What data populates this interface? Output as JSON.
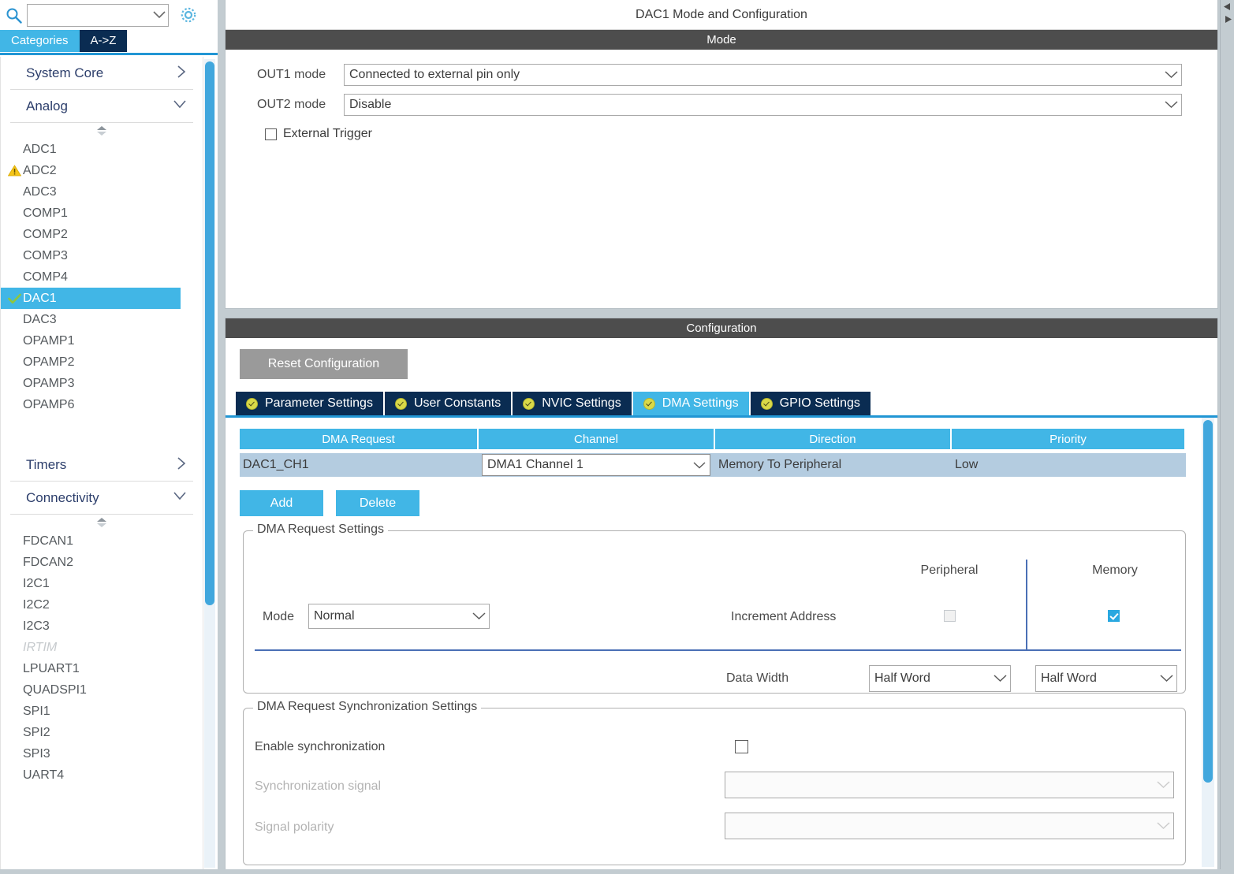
{
  "sidebar": {
    "search": {
      "icon": "search-icon",
      "value": "",
      "placeholder": ""
    },
    "gear_icon": "gear-icon",
    "mode_tabs": [
      {
        "label": "Categories",
        "selected": true
      },
      {
        "label": "A->Z",
        "selected": false
      }
    ],
    "groups": [
      {
        "name": "System Core",
        "arrow": "›",
        "expanded": false,
        "items": []
      },
      {
        "name": "Analog",
        "arrow": "∨",
        "expanded": true,
        "items": [
          {
            "label": "ADC1",
            "icon": "",
            "state": "normal"
          },
          {
            "label": "ADC2",
            "icon": "warning-icon",
            "state": "warning"
          },
          {
            "label": "ADC3",
            "icon": "",
            "state": "normal"
          },
          {
            "label": "COMP1",
            "icon": "",
            "state": "normal"
          },
          {
            "label": "COMP2",
            "icon": "",
            "state": "normal"
          },
          {
            "label": "COMP3",
            "icon": "",
            "state": "normal"
          },
          {
            "label": "COMP4",
            "icon": "",
            "state": "normal"
          },
          {
            "label": "DAC1",
            "icon": "check-icon",
            "state": "selected"
          },
          {
            "label": "DAC3",
            "icon": "",
            "state": "normal"
          },
          {
            "label": "OPAMP1",
            "icon": "",
            "state": "normal"
          },
          {
            "label": "OPAMP2",
            "icon": "",
            "state": "normal"
          },
          {
            "label": "OPAMP3",
            "icon": "",
            "state": "normal"
          },
          {
            "label": "OPAMP6",
            "icon": "",
            "state": "normal"
          }
        ]
      },
      {
        "name": "Timers",
        "arrow": "›",
        "expanded": false,
        "items": []
      },
      {
        "name": "Connectivity",
        "arrow": "∨",
        "expanded": true,
        "items": [
          {
            "label": "FDCAN1",
            "icon": "",
            "state": "normal"
          },
          {
            "label": "FDCAN2",
            "icon": "",
            "state": "normal"
          },
          {
            "label": "I2C1",
            "icon": "",
            "state": "normal"
          },
          {
            "label": "I2C2",
            "icon": "",
            "state": "normal"
          },
          {
            "label": "I2C3",
            "icon": "",
            "state": "normal"
          },
          {
            "label": "IRTIM",
            "icon": "",
            "state": "disabled"
          },
          {
            "label": "LPUART1",
            "icon": "",
            "state": "normal"
          },
          {
            "label": "QUADSPI1",
            "icon": "",
            "state": "normal"
          },
          {
            "label": "SPI1",
            "icon": "",
            "state": "normal"
          },
          {
            "label": "SPI2",
            "icon": "",
            "state": "normal"
          },
          {
            "label": "SPI3",
            "icon": "",
            "state": "normal"
          },
          {
            "label": "UART4",
            "icon": "",
            "state": "normal"
          }
        ]
      }
    ]
  },
  "main": {
    "title": "DAC1 Mode and Configuration",
    "mode_band": "Mode",
    "mode": {
      "out1_label": "OUT1 mode",
      "out1_value": "Connected to external pin only",
      "out2_label": "OUT2 mode",
      "out2_value": "Disable",
      "external_trigger_label": "External Trigger",
      "external_trigger_checked": false
    },
    "configuration_band": "Configuration",
    "reset_button": "Reset Configuration",
    "tabs": [
      {
        "label": "Parameter Settings",
        "active": false,
        "icon": "check-circle-icon"
      },
      {
        "label": "User Constants",
        "active": false,
        "icon": "check-circle-icon"
      },
      {
        "label": "NVIC Settings",
        "active": false,
        "icon": "check-circle-icon"
      },
      {
        "label": "DMA Settings",
        "active": true,
        "icon": "check-circle-icon"
      },
      {
        "label": "GPIO Settings",
        "active": false,
        "icon": "check-circle-icon"
      }
    ],
    "dma_table": {
      "columns": [
        "DMA Request",
        "Channel",
        "Direction",
        "Priority"
      ],
      "rows": [
        {
          "dma_request": "DAC1_CH1",
          "channel": "DMA1 Channel 1",
          "direction": "Memory To Peripheral",
          "priority": "Low"
        }
      ]
    },
    "table_buttons": {
      "add": "Add",
      "delete": "Delete"
    },
    "request_settings": {
      "title": "DMA Request Settings",
      "mode_label": "Mode",
      "mode_value": "Normal",
      "col_peripheral": "Peripheral",
      "col_memory": "Memory",
      "increment_address_label": "Increment Address",
      "increment_peripheral_checked": false,
      "increment_memory_checked": true,
      "data_width_label": "Data Width",
      "data_width_peripheral": "Half Word",
      "data_width_memory": "Half Word"
    },
    "sync_settings": {
      "title": "DMA Request Synchronization Settings",
      "enable_label": "Enable synchronization",
      "enable_checked": false,
      "signal_label": "Synchronization signal",
      "signal_value": "",
      "polarity_label": "Signal polarity",
      "polarity_value": ""
    }
  },
  "colors": {
    "accent_blue": "#41b6e6",
    "dark_navy": "#0a2c52",
    "band_gray": "#4d4d4d",
    "row_blue": "#b4cce0",
    "warning_yellow": "#f5c518",
    "check_green": "#8ec63f"
  }
}
